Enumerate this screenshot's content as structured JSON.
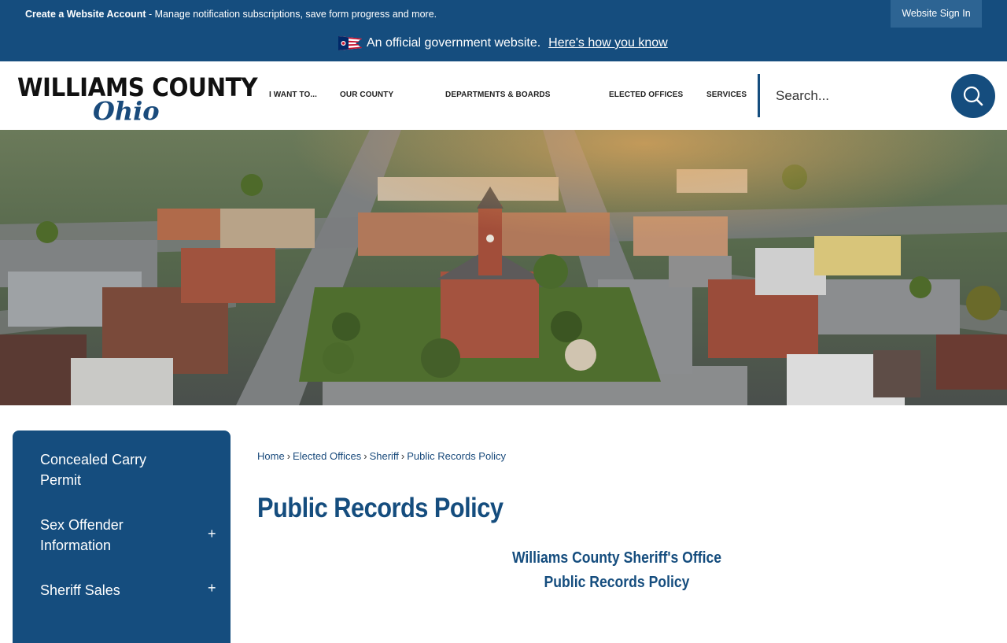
{
  "topbar": {
    "account_link": "Create a Website Account",
    "account_desc": " - Manage notification subscriptions, save form progress and more.",
    "signin_label": "Website Sign In"
  },
  "govbar": {
    "text": "An official government website.",
    "link": "Here's how you know",
    "flag_icon": "ohio-flag-icon"
  },
  "header": {
    "logo_line1": "WILLIAMS COUNTY",
    "logo_line2": "Ohio",
    "nav": [
      "I WANT TO...",
      "OUR COUNTY",
      "DEPARTMENTS & BOARDS",
      "ELECTED OFFICES",
      "SERVICES"
    ],
    "search_placeholder": "Search...",
    "search_icon": "search-icon"
  },
  "banner": {
    "description_icon": "aerial-town-photo"
  },
  "sidebar": {
    "items": [
      {
        "label": "Concealed Carry Permit",
        "toggle": ""
      },
      {
        "label": "Sex Offender Information",
        "toggle": "+"
      },
      {
        "label": "Sheriff Sales",
        "toggle": "+"
      }
    ]
  },
  "breadcrumb": [
    "Home",
    "Elected Offices",
    "Sheriff",
    "Public Records Policy"
  ],
  "main": {
    "title": "Public Records Policy",
    "subhead1": "Williams County Sheriff's Office",
    "subhead2": "Public Records Policy"
  },
  "colors": {
    "brand": "#154d7e",
    "accent": "#2d6493"
  }
}
